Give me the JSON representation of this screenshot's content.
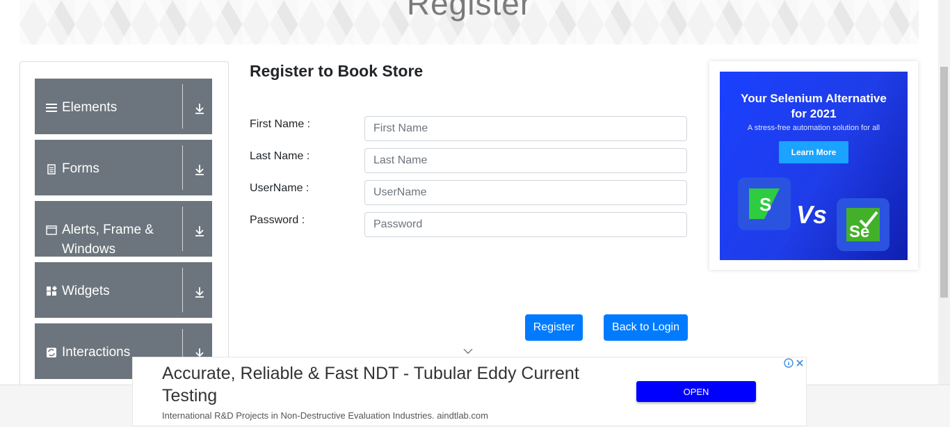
{
  "banner": {
    "title": "Register"
  },
  "nav": {
    "groups": [
      {
        "label": "Elements",
        "icon": "hamburger-icon"
      },
      {
        "label": "Forms",
        "icon": "document-icon"
      },
      {
        "label": "Alerts, Frame & Windows",
        "icon": "window-icon"
      },
      {
        "label": "Widgets",
        "icon": "widgets-icon"
      },
      {
        "label": "Interactions",
        "icon": "interactions-icon"
      }
    ]
  },
  "form": {
    "title": "Register to Book Store",
    "first_name_label": "First Name :",
    "first_name_placeholder": "First Name",
    "last_name_label": "Last Name :",
    "last_name_placeholder": "Last Name",
    "username_label": "UserName :",
    "username_placeholder": "UserName",
    "password_label": "Password :",
    "password_placeholder": "Password",
    "register_label": "Register",
    "back_label": "Back to Login"
  },
  "side_ad": {
    "headline_line1": "Your Selenium Alternative",
    "headline_line2": "for 2021",
    "subtext": "A stress-free automation solution for all",
    "button_label": "Learn More",
    "vs_text": "Vs"
  },
  "bottom_ad": {
    "headline": "Accurate, Reliable & Fast NDT - Tubular Eddy Current Testing",
    "subtext": "International R&D Projects in Non-Destructive Evaluation Industries. aindtlab.com",
    "button_label": "OPEN"
  },
  "colors": {
    "primary_button": "#007bff",
    "nav_group_bg": "#6c757d",
    "ad_blue": "#1f3de8",
    "open_button": "#0000ff"
  }
}
